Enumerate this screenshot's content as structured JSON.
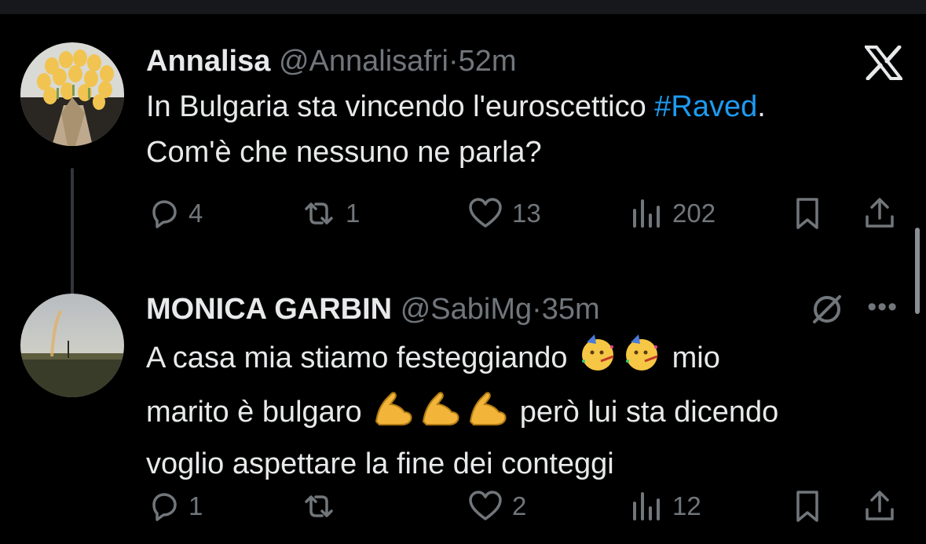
{
  "tweets": [
    {
      "name": "Annalisa",
      "handle": "@Annalisafri",
      "separator": "·",
      "time": "52m",
      "text_before": "In Bulgaria  sta vincendo l'euroscettico ",
      "hashtag": "#Raved",
      "text_after": ".",
      "text_line2": "Com'è che nessuno ne parla?",
      "replies": "4",
      "reposts": "1",
      "likes": "13",
      "views": "202"
    },
    {
      "name": "MONICA GARBIN",
      "handle": "@SabiMg",
      "separator": "·",
      "time": "35m",
      "line1_before": "A casa mia stiamo festeggiando ",
      "line1_after": " mio",
      "line2_before": "marito è bulgaro ",
      "line2_after": " però lui sta dicendo",
      "line3": "voglio aspettare la fine dei conteggi",
      "replies": "1",
      "reposts": "",
      "likes": "2",
      "views": "12",
      "emoji_party": "partying-face-emoji",
      "emoji_muscle": "flexed-biceps-emoji"
    }
  ],
  "colors": {
    "background": "#000000",
    "text": "#e7e9ea",
    "muted": "#71767b",
    "link": "#1d9bf0"
  },
  "more_label": "•••"
}
